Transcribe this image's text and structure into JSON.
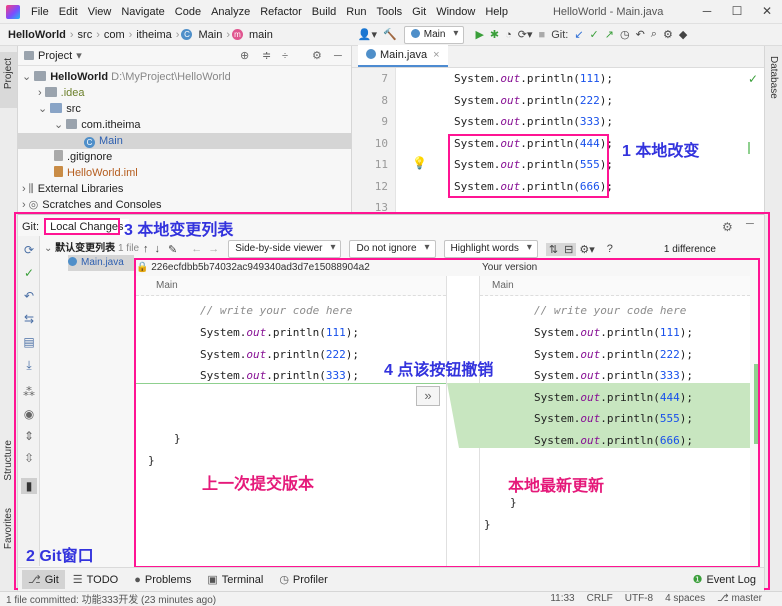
{
  "menu": {
    "items": [
      "File",
      "Edit",
      "View",
      "Navigate",
      "Code",
      "Analyze",
      "Refactor",
      "Build",
      "Run",
      "Tools",
      "Git",
      "Window",
      "Help"
    ],
    "window_title": "HelloWorld - Main.java"
  },
  "nav": {
    "breadcrumb": [
      "HelloWorld",
      "src",
      "com",
      "itheima",
      "Main",
      "main"
    ],
    "run_config": "Main",
    "git_label": "Git:"
  },
  "sidebar": {
    "project": "Project",
    "structure": "Structure",
    "favorites": "Favorites",
    "database": "Database"
  },
  "project": {
    "header": "Project",
    "root": "HelloWorld",
    "root_path": "D:\\MyProject\\HelloWorld",
    "items": {
      "idea": ".idea",
      "src": "src",
      "pkg": "com.itheima",
      "main": "Main",
      "gitignore": ".gitignore",
      "iml": "HelloWorld.iml",
      "libs": "External Libraries",
      "scratches": "Scratches and Consoles"
    }
  },
  "editor": {
    "tab": "Main.java",
    "lines": [
      {
        "n": "7",
        "pre": "System.",
        "out": "out",
        "post": ".println(",
        "num": "111",
        "end": ");"
      },
      {
        "n": "8",
        "pre": "System.",
        "out": "out",
        "post": ".println(",
        "num": "222",
        "end": ");"
      },
      {
        "n": "9",
        "pre": "System.",
        "out": "out",
        "post": ".println(",
        "num": "333",
        "end": ");"
      },
      {
        "n": "10",
        "pre": "System.",
        "out": "out",
        "post": ".println(",
        "num": "444",
        "end": ");"
      },
      {
        "n": "11",
        "pre": "System.",
        "out": "out",
        "post": ".println(",
        "num": "555",
        "end": ");"
      },
      {
        "n": "12",
        "pre": "System.",
        "out": "out",
        "post": ".println(",
        "num": "666",
        "end": ");"
      },
      {
        "n": "13",
        "pre": "",
        "out": "",
        "post": "",
        "num": "",
        "end": ""
      }
    ]
  },
  "annotations": {
    "a1": "1 本地改变",
    "a2": "2 Git窗口",
    "a3": "3 本地变更列表",
    "a4": "4 点该按钮撤销",
    "left_label": "上一次提交版本",
    "right_label": "本地最新更新"
  },
  "git": {
    "label": "Git:",
    "tab": "Local Changes",
    "changelist": "默认变更列表",
    "changelist_count": "1 file",
    "file": "Main.java",
    "viewer": "Side-by-side viewer",
    "ignore": "Do not ignore",
    "highlight": "Highlight words",
    "help": "?",
    "differences": "1 difference",
    "left_header": "226ecfdbb5b74032ac949340ad3d7e15088904a2",
    "right_header": "Your version",
    "left_tag": "Main",
    "right_tag": "Main",
    "comment": "// write your code here",
    "revert_glyph": "»",
    "close_brace": "}"
  },
  "bottom": {
    "git": "Git",
    "todo": "TODO",
    "problems": "Problems",
    "terminal": "Terminal",
    "profiler": "Profiler",
    "event_log": "Event Log"
  },
  "status": {
    "message": "1 file committed: 功能333开发 (23 minutes ago)",
    "position": "11:33",
    "line_sep": "CRLF",
    "encoding": "UTF-8",
    "indent": "4 spaces",
    "branch": "master"
  },
  "colors": {
    "accent": "#4d8bd1",
    "annotation_blue": "#3333dd",
    "annotation_red": "#e5197a",
    "highlight_box": "#ff1493",
    "diff_green": "#c8e6c0"
  }
}
